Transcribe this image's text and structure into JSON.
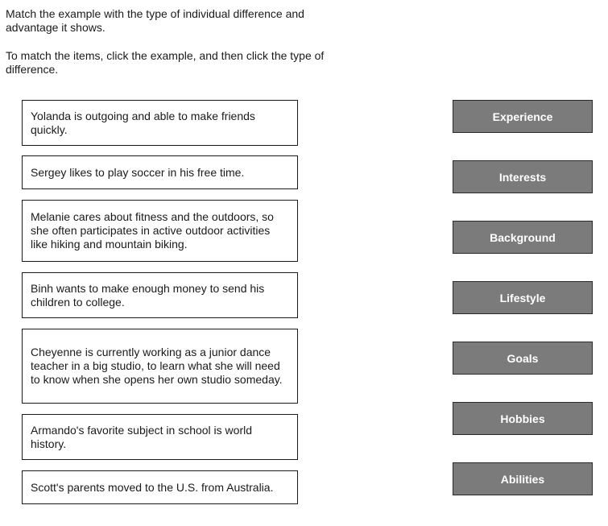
{
  "instructions": {
    "line1": "Match the example with the type of individual difference and advantage it shows.",
    "line2": "To match the items, click the example, and then click the type of difference."
  },
  "examples": [
    "Yolanda is outgoing and able to make friends quickly.",
    "Sergey likes to play soccer in his free time.",
    "Melanie cares about fitness and the outdoors, so she often participates in active outdoor activities like hiking and mountain biking.",
    "Binh wants to make enough money to send his children to college.",
    "Cheyenne is currently working as a junior dance teacher in a big studio, to learn what she will need to know when she opens her own studio someday.",
    "Armando's favorite subject in school is world history.",
    "Scott's parents moved to the U.S. from Australia."
  ],
  "categories": [
    "Experience",
    "Interests",
    "Background",
    "Lifestyle",
    "Goals",
    "Hobbies",
    "Abilities"
  ],
  "colors": {
    "category_bg": "#7b7b7b",
    "category_text": "#ffffff",
    "border": "#1a1a1a"
  }
}
